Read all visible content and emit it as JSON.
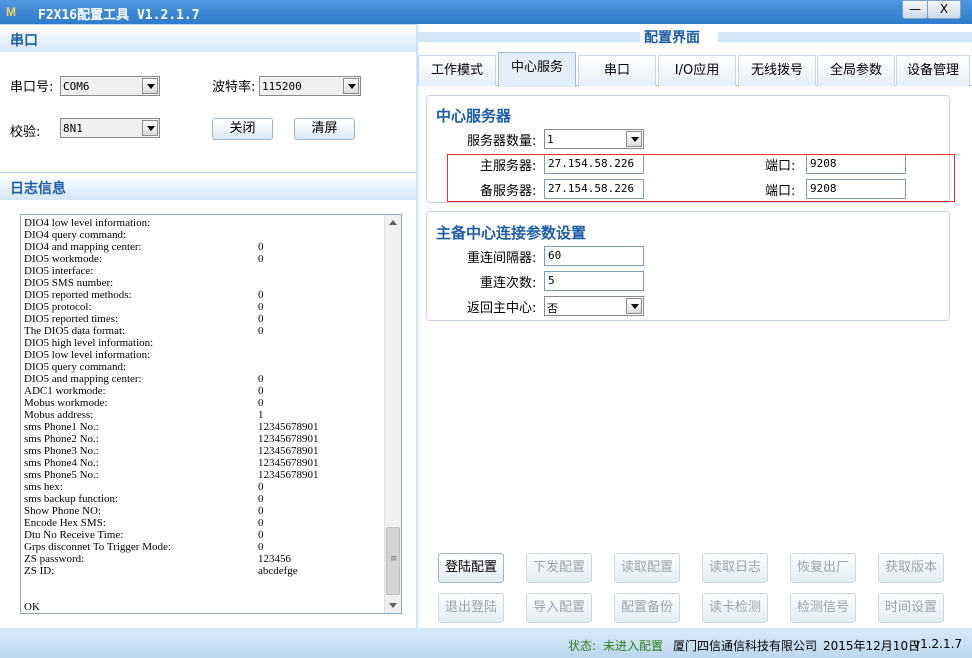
{
  "titlebar": {
    "icon": "M",
    "title": "F2X16配置工具 V1.2.1.7",
    "min": "—",
    "close": "X"
  },
  "serial": {
    "header": "串口",
    "port_label": "串口号:",
    "port_value": "COM6",
    "baud_label": "波特率:",
    "baud_value": "115200",
    "check_label": "校验:",
    "check_value": "8N1",
    "close_button": "关闭",
    "clear_button": "清屏"
  },
  "log": {
    "header": "日志信息",
    "lines": [
      {
        "k": "DIO4 low level information:",
        "v": ""
      },
      {
        "k": "DIO4 query command:",
        "v": ""
      },
      {
        "k": "DIO4 and mapping center:",
        "v": "0"
      },
      {
        "k": "DIO5 workmode:",
        "v": "0"
      },
      {
        "k": "DIO5 interface:",
        "v": ""
      },
      {
        "k": "DIO5 SMS number:",
        "v": ""
      },
      {
        "k": "DIO5 reported methods:",
        "v": "0"
      },
      {
        "k": "DIO5 protocol:",
        "v": "0"
      },
      {
        "k": "DIO5 reported times:",
        "v": "0"
      },
      {
        "k": "The DIO5 data format:",
        "v": "0"
      },
      {
        "k": "DIO5 high level information:",
        "v": ""
      },
      {
        "k": "DIO5 low level information:",
        "v": ""
      },
      {
        "k": "DIO5 query command:",
        "v": ""
      },
      {
        "k": "DIO5 and mapping center:",
        "v": "0"
      },
      {
        "k": "ADC1 workmode:",
        "v": "0"
      },
      {
        "k": "Mobus workmode:",
        "v": "0"
      },
      {
        "k": "Mobus address:",
        "v": "1"
      },
      {
        "k": "sms Phone1 No.:",
        "v": "12345678901"
      },
      {
        "k": "sms Phone2 No.:",
        "v": "12345678901"
      },
      {
        "k": "sms Phone3 No.:",
        "v": "12345678901"
      },
      {
        "k": "sms Phone4 No.:",
        "v": "12345678901"
      },
      {
        "k": "sms Phone5 No.:",
        "v": "12345678901"
      },
      {
        "k": "sms hex:",
        "v": "0"
      },
      {
        "k": "sms backup function:",
        "v": "0"
      },
      {
        "k": "Show Phone NO:",
        "v": "0"
      },
      {
        "k": "Encode Hex SMS:",
        "v": "0"
      },
      {
        "k": "Dtu No Receive Time:",
        "v": "0"
      },
      {
        "k": "Grps disconnet To Trigger Mode:",
        "v": "0"
      },
      {
        "k": "ZS password:",
        "v": "123456"
      },
      {
        "k": "ZS ID:",
        "v": "abcdefge"
      },
      {
        "k": "",
        "v": ""
      },
      {
        "k": "",
        "v": ""
      },
      {
        "k": "OK",
        "v": ""
      }
    ]
  },
  "config": {
    "title": "配置界面",
    "tabs": [
      "工作模式",
      "中心服务",
      "串口",
      "I/O应用",
      "无线拨号",
      "全局参数",
      "设备管理"
    ],
    "active_tab": 1,
    "center": {
      "title": "中心服务器",
      "count_label": "服务器数量:",
      "count_value": "1",
      "main_label": "主服务器:",
      "main_value": "27.154.58.226",
      "main_port_label": "端口:",
      "main_port_value": "9208",
      "backup_label": "备服务器:",
      "backup_value": "27.154.58.226",
      "backup_port_label": "端口:",
      "backup_port_value": "9208"
    },
    "reconnect": {
      "title": "主备中心连接参数设置",
      "interval_label": "重连间隔器:",
      "interval_value": "60",
      "times_label": "重连次数:",
      "times_value": "5",
      "return_label": "返回主中心:",
      "return_value": "否"
    },
    "buttons_row1": [
      "登陆配置",
      "下发配置",
      "读取配置",
      "读取日志",
      "恢复出厂",
      "获取版本"
    ],
    "buttons_row2": [
      "退出登陆",
      "导入配置",
      "配置备份",
      "读卡检测",
      "检测信号",
      "时间设置"
    ]
  },
  "status": {
    "label": "状态:",
    "state": "未进入配置",
    "company": "厦门四信通信科技有限公司",
    "date": "2015年12月10日",
    "version": "v1.2.1.7"
  },
  "colors": {
    "accent": "#1f5da8",
    "status_green": "#2e7d1a",
    "highlight": "#e53030"
  }
}
